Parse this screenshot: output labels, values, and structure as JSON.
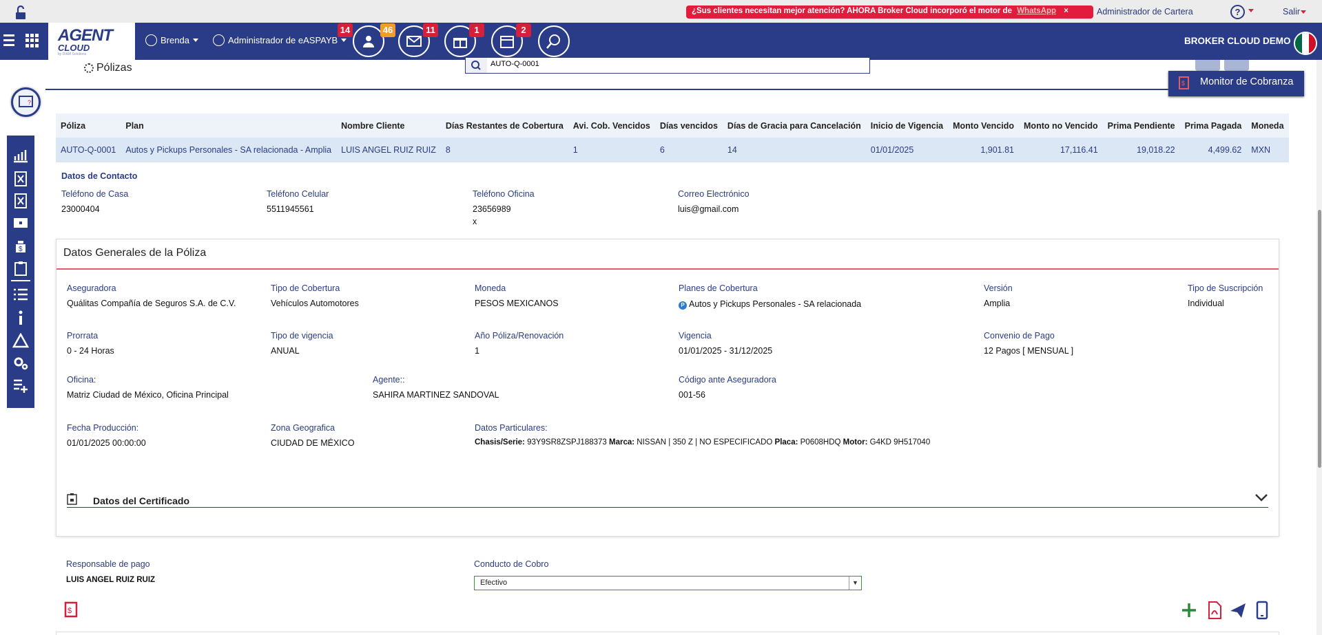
{
  "promo": {
    "text": "¿Sus clientes necesitan mejor atención? AHORA Broker Cloud incorporó el motor de",
    "link": "WhatsApp",
    "close": "×"
  },
  "topbar": {
    "admin_cartera": "Administrador de Cartera",
    "help": "?",
    "salir": "Salir"
  },
  "nav": {
    "logo_line1": "AGENT",
    "logo_line2": "CLOUD",
    "logo_tagline": "by DIAM Solutions",
    "user": "Brenda",
    "profile": "Administrador de eASPAYB",
    "badges": {
      "clients": "14",
      "clients_alt": "46",
      "mail": "11",
      "gifts": "1",
      "calendar": "2"
    },
    "broker": "BROKER CLOUD DEMO"
  },
  "colors": {
    "primary": "#2a3c87",
    "alert": "#d4203a",
    "accent_line": "#e8595e",
    "row_highlight": "#dbe7f5"
  },
  "page": {
    "title": "Pólizas",
    "search_value": "AUTO-Q-0001",
    "monitor_label": "Monitor de Cobranza"
  },
  "table": {
    "headers": [
      "Póliza",
      "Plan",
      "Nombre Cliente",
      "Días Restantes de Cobertura",
      "Avi. Cob. Vencidos",
      "Días vencidos",
      "Días de Gracia para Cancelación",
      "Inicio de Vigencia",
      "Monto Vencido",
      "Monto no Vencido",
      "Prima Pendiente",
      "Prima Pagada",
      "Moneda"
    ],
    "row": [
      "AUTO-Q-0001",
      "Autos y Pickups Personales - SA relacionada - Amplia",
      "LUIS ANGEL RUIZ RUIZ",
      "8",
      "1",
      "6",
      "14",
      "01/01/2025",
      "1,901.81",
      "17,116.41",
      "19,018.22",
      "4,499.62",
      "MXN"
    ]
  },
  "contact": {
    "title": "Datos de Contacto",
    "home_label": "Teléfono de Casa",
    "home": "23000404",
    "cell_label": "Teléfono Celular",
    "cell": "5511945561",
    "office_label": "Teléfono Oficina",
    "office": "23656989",
    "office_ext": "x",
    "email_label": "Correo Electrónico",
    "email": "luis@gmail.com"
  },
  "general": {
    "title": "Datos Generales de la Póliza",
    "aseguradora_label": "Aseguradora",
    "aseguradora": "Quálitas Compañía de Seguros S.A. de C.V.",
    "tipo_cob_label": "Tipo de Cobertura",
    "tipo_cob": "Vehículos Automotores",
    "moneda_label": "Moneda",
    "moneda": "PESOS MEXICANOS",
    "planes_label": "Planes de Cobertura",
    "plan_badge": "P",
    "planes": "Autos y Pickups Personales - SA relacionada",
    "version_label": "Versión",
    "version": "Amplia",
    "suscripcion_label": "Tipo de Suscripción",
    "suscripcion": "Individual",
    "prorrata_label": "Prorrata",
    "prorrata": "0 - 24 Horas",
    "tipo_vig_label": "Tipo de vigencia",
    "tipo_vig": "ANUAL",
    "anio_label": "Año Póliza/Renovación",
    "anio": "1",
    "vigencia_label": "Vigencia",
    "vigencia": "01/01/2025 - 31/12/2025",
    "convenio_label": "Convenio de Pago",
    "convenio": "12 Pagos [ MENSUAL ]",
    "oficina_label": "Oficina:",
    "oficina": "Matriz Ciudad de México, Oficina Principal",
    "agente_label": "Agente::",
    "agente": "SAHIRA MARTINEZ SANDOVAL",
    "codigo_label": "Código ante Aseguradora",
    "codigo": "001-56",
    "fecha_label": "Fecha Producción:",
    "fecha": "01/01/2025 00:00:00",
    "zona_label": "Zona Geografica",
    "zona": "CIUDAD DE MÉXICO",
    "particulares_label": "Datos Particulares:",
    "part": {
      "chasis_k": "Chasis/Serie:",
      "chasis_v": "93Y9SR8ZSPJ188373",
      "marca_k": "Marca:",
      "marca_v": "NISSAN | 350 Z | NO ESPECIFICADO",
      "placa_k": "Placa:",
      "placa_v": "P0608HDQ",
      "motor_k": "Motor:",
      "motor_v": "G4KD 9H517040"
    },
    "cert_title": "Datos del Certificado"
  },
  "payment": {
    "resp_label": "Responsable de pago",
    "resp": "LUIS ANGEL RUIZ RUIZ",
    "conducto_label": "Conducto de Cobro",
    "conducto": "Efectivo"
  }
}
